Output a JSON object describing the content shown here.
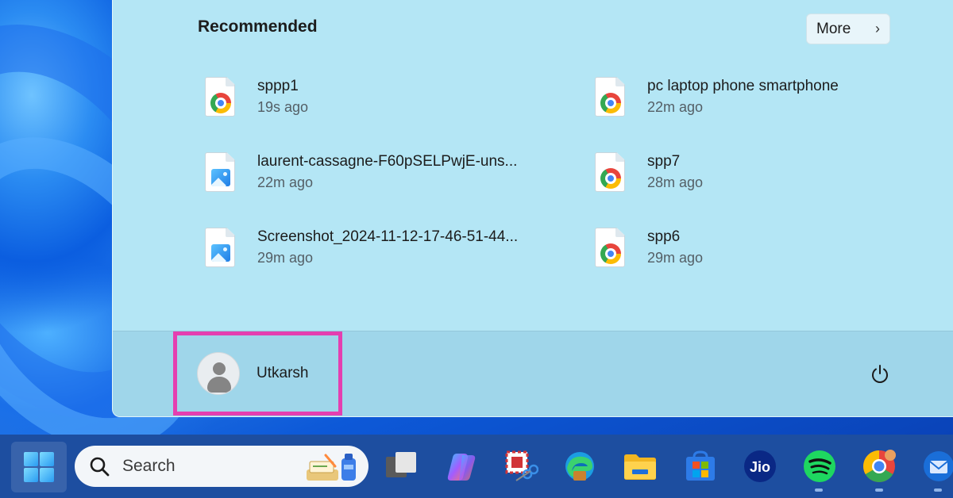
{
  "start_menu": {
    "recommended": {
      "title": "Recommended",
      "more_label": "More",
      "items": [
        {
          "name": "sppp1",
          "time": "19s ago",
          "icon": "chrome-icon"
        },
        {
          "name": "pc laptop phone smartphone",
          "time": "22m ago",
          "icon": "chrome-icon"
        },
        {
          "name": "laurent-cassagne-F60pSELPwjE-uns...",
          "time": "22m ago",
          "icon": "image-icon"
        },
        {
          "name": "spp7",
          "time": "28m ago",
          "icon": "chrome-icon"
        },
        {
          "name": "Screenshot_2024-11-12-17-46-51-44...",
          "time": "29m ago",
          "icon": "image-icon"
        },
        {
          "name": "spp6",
          "time": "29m ago",
          "icon": "chrome-icon"
        }
      ]
    },
    "user": {
      "name": "Utkarsh"
    },
    "power_icon": "power-icon"
  },
  "taskbar": {
    "search_placeholder": "Search",
    "apps": [
      {
        "name": "task-view",
        "icon": "task-view-icon"
      },
      {
        "name": "copilot",
        "icon": "copilot-icon"
      },
      {
        "name": "snipping-tool",
        "icon": "snipping-tool-icon"
      },
      {
        "name": "edge",
        "icon": "edge-icon"
      },
      {
        "name": "file-explorer",
        "icon": "folder-icon"
      },
      {
        "name": "microsoft-store",
        "icon": "store-icon"
      },
      {
        "name": "jio",
        "icon": "jio-icon",
        "label": "Jio"
      },
      {
        "name": "spotify",
        "icon": "spotify-icon"
      },
      {
        "name": "chrome",
        "icon": "chrome-icon"
      },
      {
        "name": "thunderbird",
        "icon": "thunderbird-icon"
      }
    ]
  },
  "colors": {
    "highlight_box": "#e43fb0",
    "panel_bg": "#b4e6f5",
    "taskbar_bg": "#1d4ea0"
  }
}
